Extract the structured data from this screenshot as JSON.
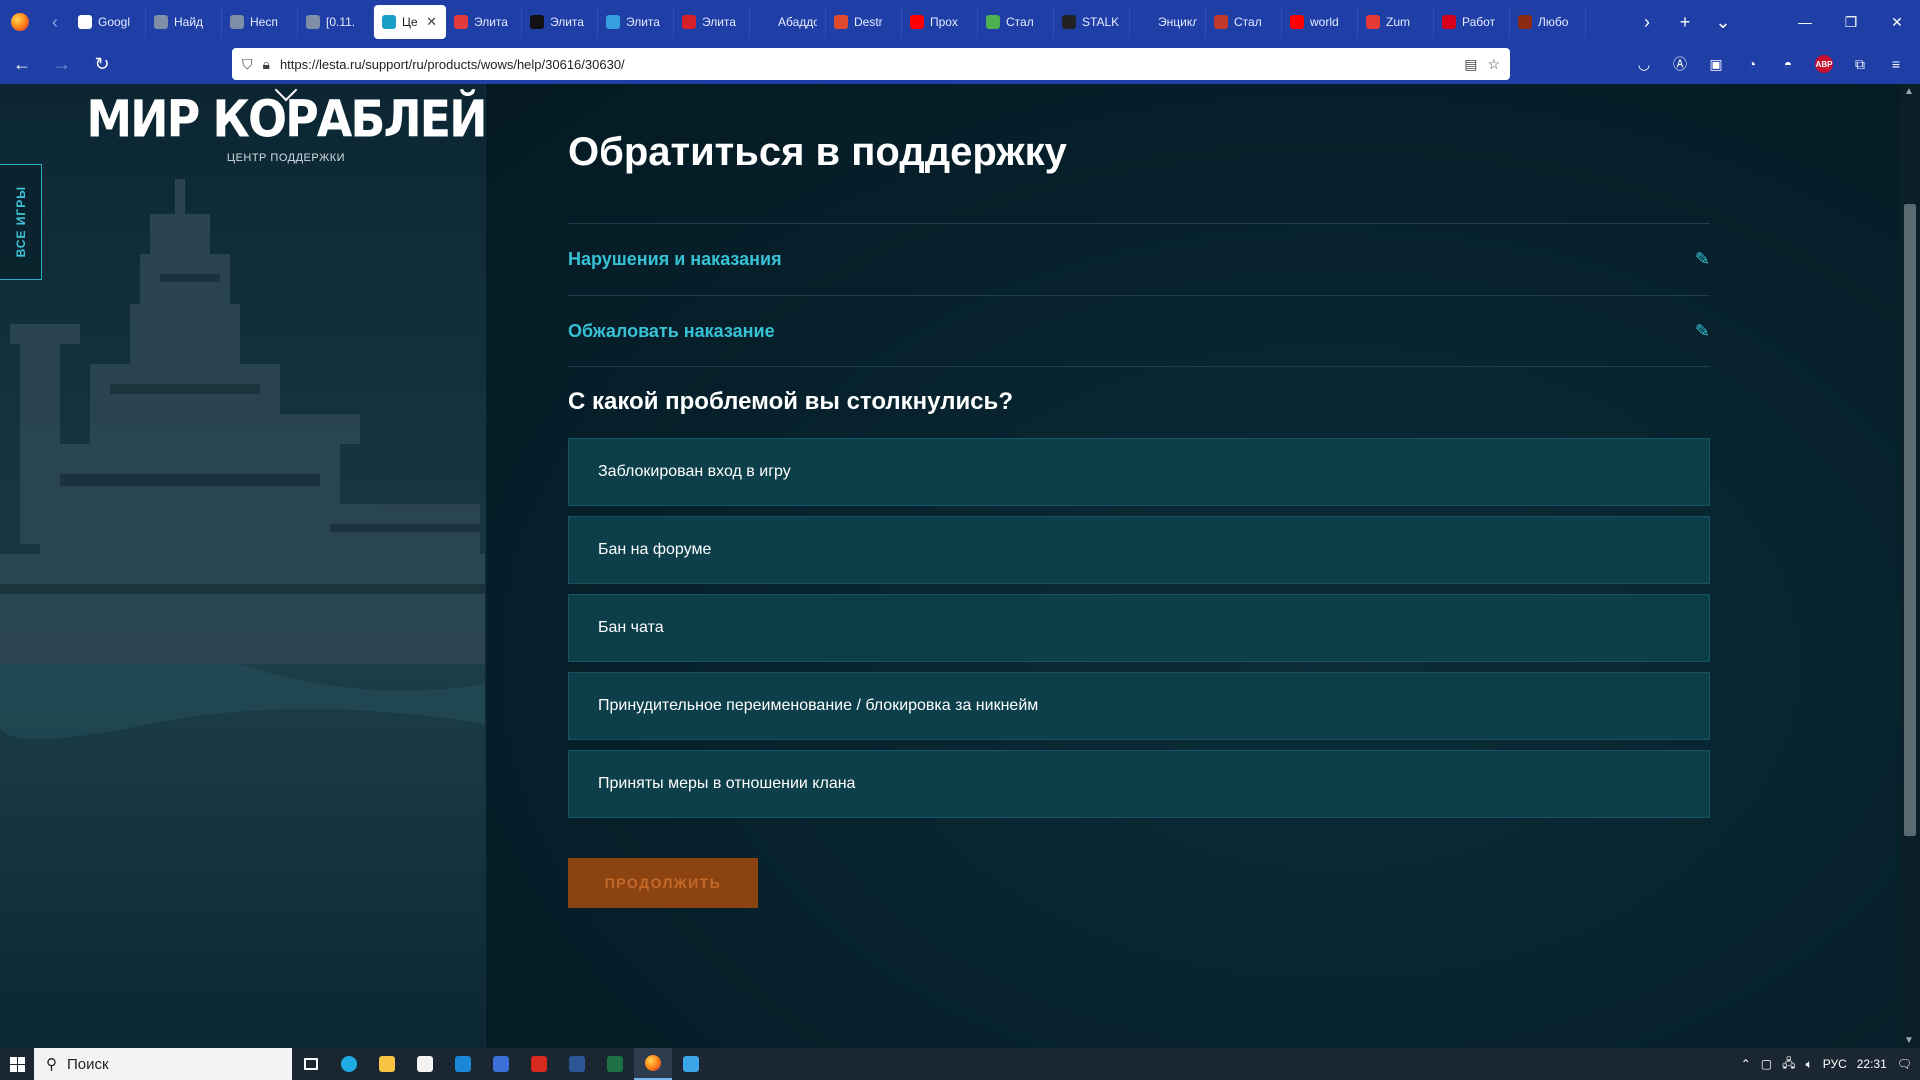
{
  "browser": {
    "tabs": [
      {
        "title": "Googl",
        "color": "#ffffff"
      },
      {
        "title": "Найд",
        "color": "#7e8ea6"
      },
      {
        "title": "Несп",
        "color": "#7e8ea6"
      },
      {
        "title": "[0.11.",
        "color": "#7e8ea6"
      },
      {
        "title": "Це",
        "color": "#1aa0c8",
        "active": true
      },
      {
        "title": "Элита",
        "color": "#e23b3b"
      },
      {
        "title": "Элита",
        "color": "#111111"
      },
      {
        "title": "Элита",
        "color": "#35a0e0"
      },
      {
        "title": "Элита",
        "color": "#d61f26"
      },
      {
        "title": "Абаддон,",
        "color": "#1f3fa6"
      },
      {
        "title": "Destr",
        "color": "#e04a2a"
      },
      {
        "title": "Прох",
        "color": "#ff0000"
      },
      {
        "title": "Стал",
        "color": "#4caf50"
      },
      {
        "title": "STALK",
        "color": "#222222"
      },
      {
        "title": "Энцикло",
        "color": "#1f3fa6"
      },
      {
        "title": "Стал",
        "color": "#c0392b"
      },
      {
        "title": "world",
        "color": "#ff0000"
      },
      {
        "title": "Zum",
        "color": "#e53935"
      },
      {
        "title": "Работ",
        "color": "#d6001c"
      },
      {
        "title": "Любо",
        "color": "#8d2a12"
      }
    ],
    "url": "https://lesta.ru/support/ru/products/wows/help/30616/30630/"
  },
  "sidebar": {
    "logo": "МИР КОРАБЛЕЙ",
    "logo_sub": "ЦЕНТР ПОДДЕРЖКИ",
    "all_games": "ВСЕ ИГРЫ"
  },
  "main": {
    "title": "Обратиться в поддержку",
    "steps": [
      {
        "label": "Нарушения и наказания"
      },
      {
        "label": "Обжаловать наказание"
      }
    ],
    "question": "С какой проблемой вы столкнулись?",
    "options": [
      "Заблокирован вход в игру",
      "Бан на форуме",
      "Бан чата",
      "Принудительное переименование / блокировка за никнейм",
      "Приняты меры в отношении клана"
    ],
    "continue_label": "ПРОДОЛЖИТЬ"
  },
  "taskbar": {
    "search_placeholder": "Поиск",
    "lang": "РУС",
    "time": "22:31"
  },
  "colors": {
    "accent": "#36c2d4",
    "option_bg": "#0d3f4a",
    "button_bg": "#8c4312"
  }
}
